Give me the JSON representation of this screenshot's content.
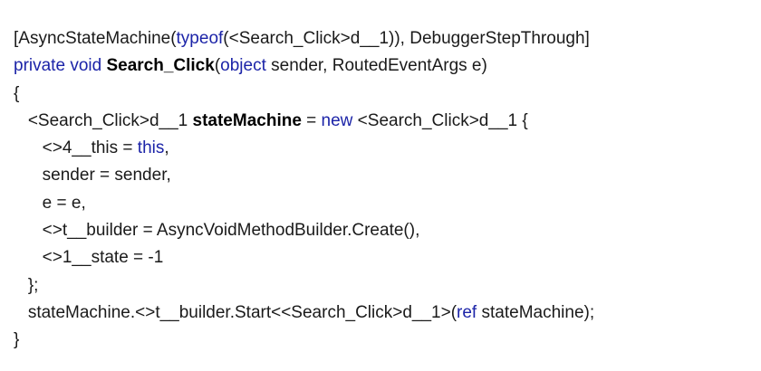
{
  "code": {
    "lines": [
      [
        {
          "text": "[AsyncStateMachine(",
          "style": "plain"
        },
        {
          "text": "typeof",
          "style": "keyword"
        },
        {
          "text": "(<Search_Click>d__1)), DebuggerStepThrough]",
          "style": "plain"
        }
      ],
      [
        {
          "text": "private",
          "style": "keyword"
        },
        {
          "text": " ",
          "style": "plain"
        },
        {
          "text": "void",
          "style": "keyword"
        },
        {
          "text": " ",
          "style": "plain"
        },
        {
          "text": "Search_Click",
          "style": "bold"
        },
        {
          "text": "(",
          "style": "plain"
        },
        {
          "text": "object",
          "style": "keyword"
        },
        {
          "text": " sender, RoutedEventArgs e)",
          "style": "plain"
        }
      ],
      [
        {
          "text": "{",
          "style": "plain"
        }
      ],
      [
        {
          "text": "   <Search_Click>d__1 ",
          "style": "plain"
        },
        {
          "text": "stateMachine",
          "style": "bold"
        },
        {
          "text": " = ",
          "style": "plain"
        },
        {
          "text": "new",
          "style": "keyword"
        },
        {
          "text": " <Search_Click>d__1 {",
          "style": "plain"
        }
      ],
      [
        {
          "text": "      <>4__this = ",
          "style": "plain"
        },
        {
          "text": "this",
          "style": "keyword"
        },
        {
          "text": ",",
          "style": "plain"
        }
      ],
      [
        {
          "text": "      sender = sender,",
          "style": "plain"
        }
      ],
      [
        {
          "text": "      e = e,",
          "style": "plain"
        }
      ],
      [
        {
          "text": "      <>t__builder = AsyncVoidMethodBuilder.Create(),",
          "style": "plain"
        }
      ],
      [
        {
          "text": "      <>1__state = -1",
          "style": "plain"
        }
      ],
      [
        {
          "text": "   };",
          "style": "plain"
        }
      ],
      [
        {
          "text": "   stateMachine.<>t__builder.Start<<Search_Click>d__1>(",
          "style": "plain"
        },
        {
          "text": "ref",
          "style": "keyword"
        },
        {
          "text": " stateMachine);",
          "style": "plain"
        }
      ],
      [
        {
          "text": "}",
          "style": "plain"
        }
      ]
    ]
  },
  "colors": {
    "keyword": "#1c24a8",
    "text": "#1a1a1a",
    "background": "#ffffff"
  }
}
